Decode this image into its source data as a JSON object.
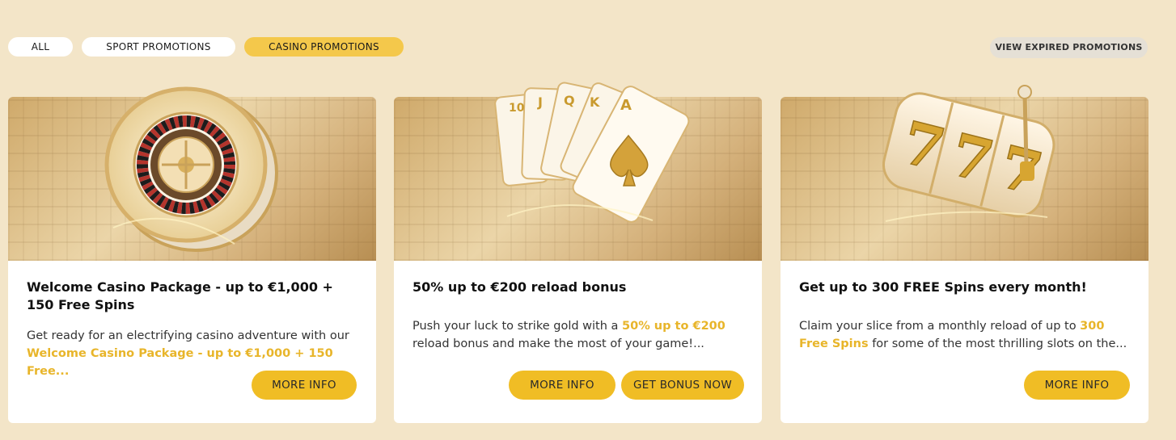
{
  "filters": {
    "all": "ALL",
    "sport": "SPORT PROMOTIONS",
    "casino": "CASINO PROMOTIONS",
    "active": "casino"
  },
  "expired_label": "VIEW EXPIRED PROMOTIONS",
  "colors": {
    "accent": "#f0bd25",
    "highlight": "#e8b52a",
    "background": "#f3e5c8"
  },
  "cards": [
    {
      "image": "roulette-wheel-image",
      "title": "Welcome Casino Package - up to €1,000 + 150 Free Spins",
      "desc_before": "Get ready for an electrifying casino adventure with our ",
      "desc_highlight": "Welcome Casino Package - up to €1,000 + 150 Free...",
      "desc_after": "",
      "more_label": "MORE INFO"
    },
    {
      "image": "playing-cards-image",
      "title": "50% up to €200 reload bonus",
      "desc_before": "Push your luck to strike gold with a ",
      "desc_highlight": "50% up to €200",
      "desc_after": " reload bonus and make the most of your game!...",
      "more_label": "MORE INFO",
      "bonus_label": "GET BONUS NOW"
    },
    {
      "image": "slot-machine-777-image",
      "title": "Get up to 300 FREE Spins every month!",
      "desc_before": "Claim your slice from a monthly reload of up to ",
      "desc_highlight": "300 Free Spins",
      "desc_after": " for some of the most thrilling slots on the...",
      "more_label": "MORE INFO"
    }
  ]
}
